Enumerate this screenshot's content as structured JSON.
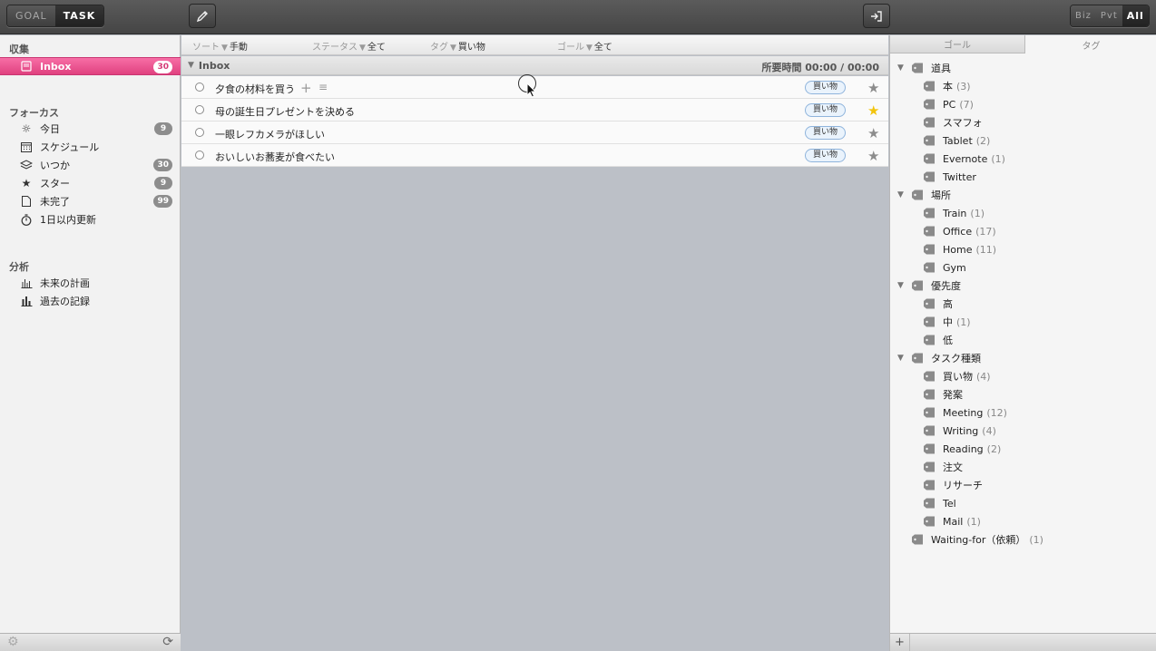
{
  "toolbar": {
    "mode": [
      "GOAL",
      "TASK"
    ],
    "scope": [
      "Biz",
      "Pvt",
      "All"
    ]
  },
  "sidebar": {
    "sections": {
      "collect": "収集",
      "focus": "フォーカス",
      "analysis": "分析"
    },
    "inbox": {
      "label": "Inbox",
      "count": "30"
    },
    "focus_items": [
      {
        "label": "今日",
        "count": "9"
      },
      {
        "label": "スケジュール",
        "count": ""
      },
      {
        "label": "いつか",
        "count": "30"
      },
      {
        "label": "スター",
        "count": "9"
      },
      {
        "label": "未完了",
        "count": "99"
      },
      {
        "label": "1日以内更新",
        "count": ""
      }
    ],
    "analysis_items": [
      {
        "label": "未来の計画"
      },
      {
        "label": "過去の記録"
      }
    ]
  },
  "filters": {
    "sort": {
      "label": "ソート",
      "value": "手動"
    },
    "status": {
      "label": "ステータス",
      "value": "全て"
    },
    "tag": {
      "label": "タグ",
      "value": "買い物"
    },
    "goal": {
      "label": "ゴール",
      "value": "全て"
    }
  },
  "group": {
    "name": "Inbox",
    "time": "所要時間 00:00 / 00:00"
  },
  "tasks": [
    {
      "title": "夕食の材料を買う",
      "tag": "買い物",
      "starred": false
    },
    {
      "title": "母の誕生日プレゼントを決める",
      "tag": "買い物",
      "starred": true
    },
    {
      "title": "一眼レフカメラがほしい",
      "tag": "買い物",
      "starred": false
    },
    {
      "title": "おいしいお蕎麦が食べたい",
      "tag": "買い物",
      "starred": false
    }
  ],
  "right_tabs": {
    "goal": "ゴール",
    "tag": "タグ"
  },
  "tag_tree": [
    {
      "name": "道具",
      "count": "",
      "level": 0,
      "group": true
    },
    {
      "name": "本",
      "count": "(3)",
      "level": 1
    },
    {
      "name": "PC",
      "count": "(7)",
      "level": 1
    },
    {
      "name": "スマフォ",
      "count": "",
      "level": 1
    },
    {
      "name": "Tablet",
      "count": "(2)",
      "level": 1
    },
    {
      "name": "Evernote",
      "count": "(1)",
      "level": 1
    },
    {
      "name": "Twitter",
      "count": "",
      "level": 1
    },
    {
      "name": "場所",
      "count": "",
      "level": 0,
      "group": true
    },
    {
      "name": "Train",
      "count": "(1)",
      "level": 1
    },
    {
      "name": "Office",
      "count": "(17)",
      "level": 1
    },
    {
      "name": "Home",
      "count": "(11)",
      "level": 1
    },
    {
      "name": "Gym",
      "count": "",
      "level": 1
    },
    {
      "name": "優先度",
      "count": "",
      "level": 0,
      "group": true
    },
    {
      "name": "高",
      "count": "",
      "level": 1
    },
    {
      "name": "中",
      "count": "(1)",
      "level": 1
    },
    {
      "name": "低",
      "count": "",
      "level": 1
    },
    {
      "name": "タスク種類",
      "count": "",
      "level": 0,
      "group": true
    },
    {
      "name": "買い物",
      "count": "(4)",
      "level": 1
    },
    {
      "name": "発案",
      "count": "",
      "level": 1
    },
    {
      "name": "Meeting",
      "count": "(12)",
      "level": 1
    },
    {
      "name": "Writing",
      "count": "(4)",
      "level": 1
    },
    {
      "name": "Reading",
      "count": "(2)",
      "level": 1
    },
    {
      "name": "注文",
      "count": "",
      "level": 1
    },
    {
      "name": "リサーチ",
      "count": "",
      "level": 1
    },
    {
      "name": "Tel",
      "count": "",
      "level": 1
    },
    {
      "name": "Mail",
      "count": "(1)",
      "level": 1
    },
    {
      "name": "Waiting-for（依頼）",
      "count": "(1)",
      "level": 0,
      "group": false
    }
  ],
  "colors": {
    "accent": "#e94b8a",
    "star_on": "#f2c40d",
    "tag_border": "#8fb4dc"
  }
}
